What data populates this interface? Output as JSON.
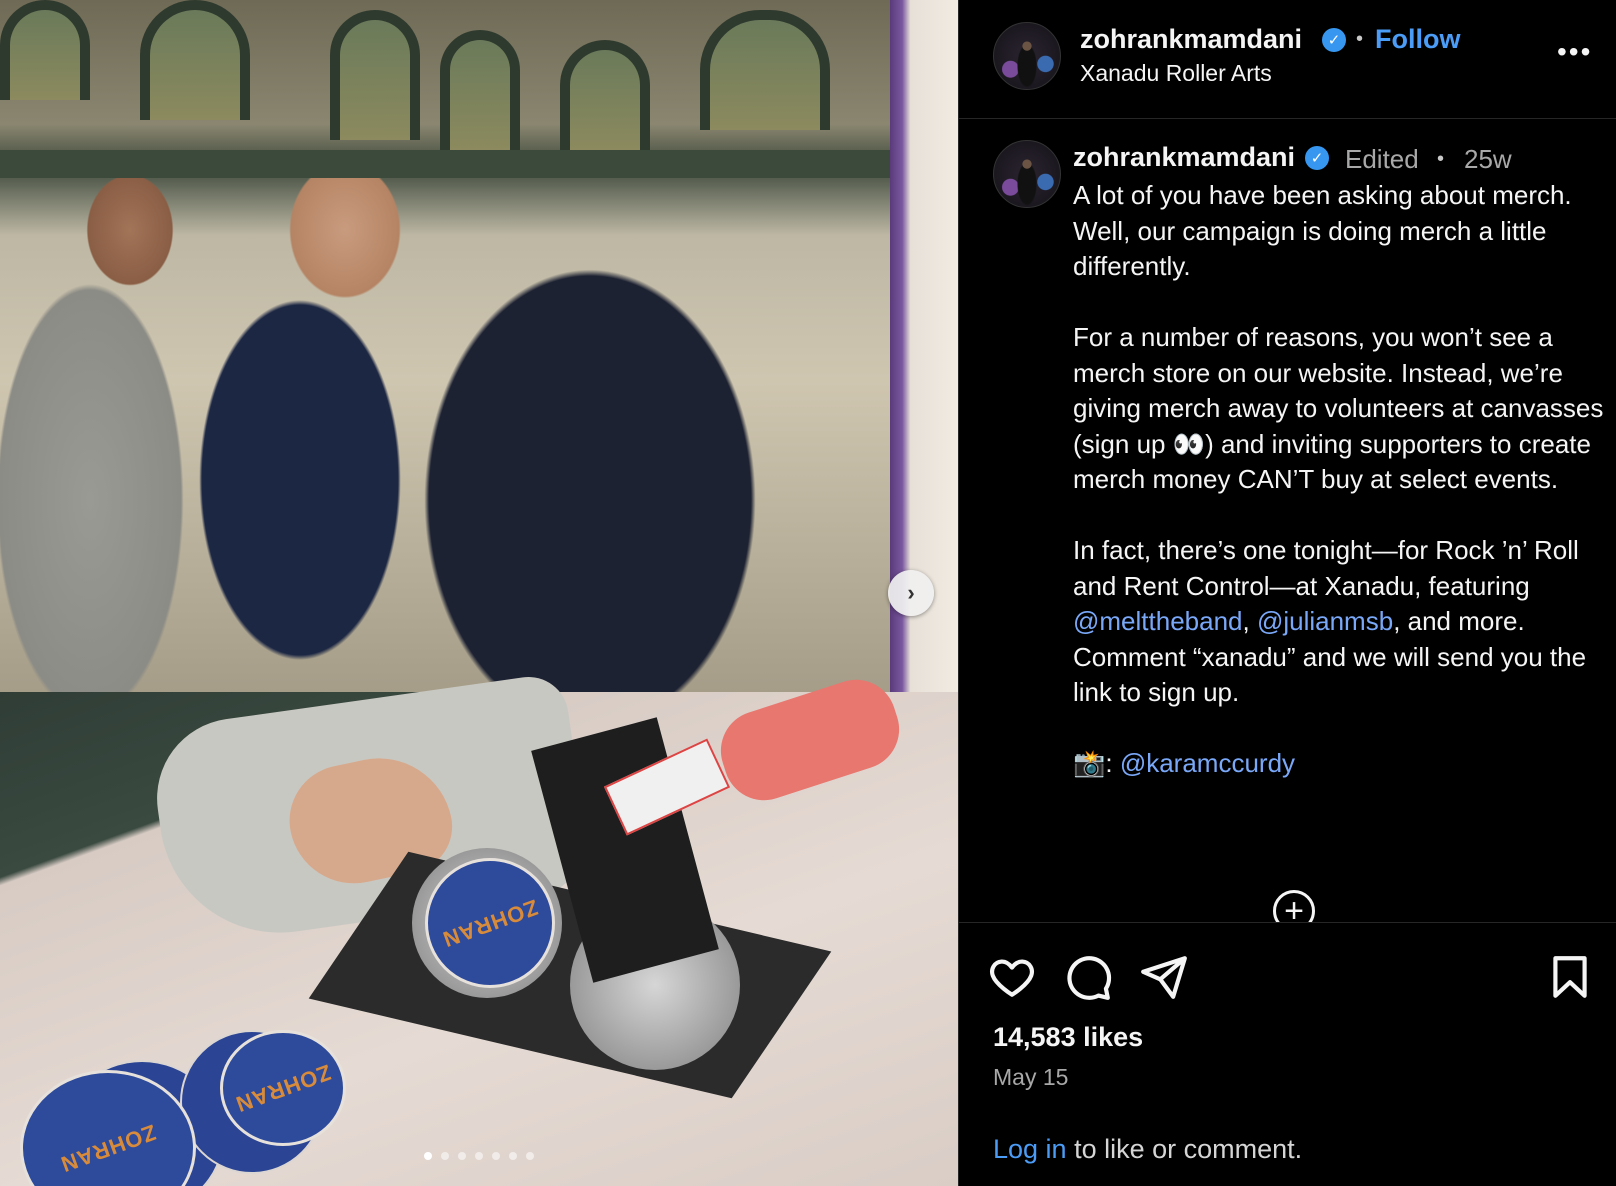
{
  "post": {
    "username": "zohrankmamdani",
    "follow_label": "Follow",
    "location": "Xanadu Roller Arts",
    "more_label": "•••",
    "sep": "•"
  },
  "caption": {
    "username": "zohrankmamdani",
    "edited_label": "Edited",
    "sep": "•",
    "age": "25w",
    "p1": "A lot of you have been asking about merch. Well, our campaign is doing merch a little differently.",
    "p2": "For a number of reasons, you won’t see a merch store on our website. Instead, we’re giving merch away to volunteers at canvasses (sign up 👀) and inviting supporters to create merch money CAN’T buy at select events.",
    "p3_a": "In fact, there’s one tonight—for Rock ’n’ Roll and Rent Control—at Xanadu, featuring ",
    "mention_1": "@melttheband",
    "p3_b": ", ",
    "mention_2": "@julianmsb",
    "p3_c": ", and more. Comment “xanadu” and we will send you the link to sign up.",
    "camera_prefix": "📸: ",
    "mention_3": "@karamccurdy"
  },
  "media": {
    "pin_text": "ZOHRAN",
    "slide_count": 7,
    "active_slide": 1,
    "next_icon": "chevron-right-icon"
  },
  "footer": {
    "likes": "14,583 likes",
    "date": "May 15",
    "login_link": "Log in",
    "login_rest": " to like or comment."
  },
  "icons": [
    "heart-icon",
    "comment-icon",
    "share-icon",
    "bookmark-icon",
    "verified-badge-icon",
    "plus-circle-icon"
  ],
  "colors": {
    "background": "#000000",
    "link": "#4a9cf7",
    "mention": "#7aa8f8",
    "verified": "#3797f0",
    "muted": "#a8a8a8"
  }
}
